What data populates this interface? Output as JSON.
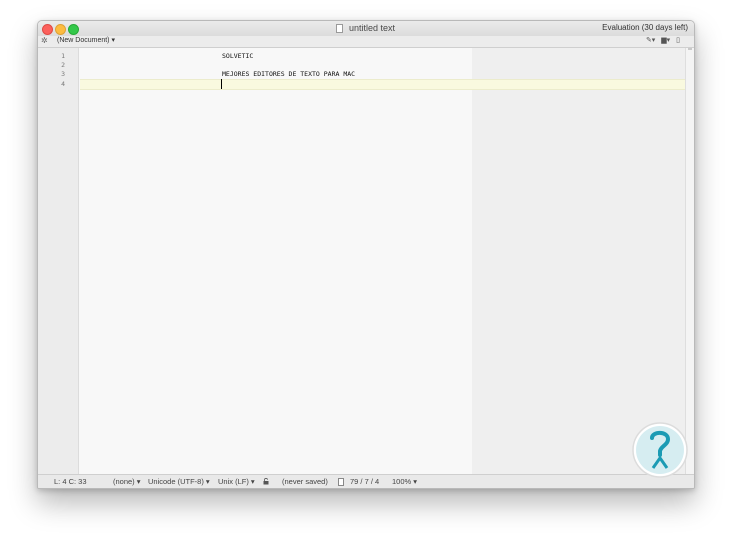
{
  "window": {
    "title": "untitled text",
    "evaluation": "Evaluation (30 days left)"
  },
  "toolbar": {
    "gear_icon": "gear-icon",
    "document_selector": "(New Document) ▾",
    "right_icons": [
      "pencil-icon",
      "copy-icon",
      "document-icon"
    ]
  },
  "editor": {
    "line_numbers": [
      "1",
      "2",
      "3",
      "4"
    ],
    "lines": [
      "SOLVETIC",
      "",
      "MEJORES EDITORES DE TEXTO PARA MAC",
      ""
    ],
    "current_line": 4
  },
  "statusbar": {
    "position": "L: 4 C: 33",
    "syntax": "(none) ▾",
    "encoding": "Unicode (UTF-8) ▾",
    "line_endings": "Unix (LF) ▾",
    "saved_state": "(never saved)",
    "counts": "79 / 7 / 4",
    "zoom": "100% ▾"
  },
  "colors": {
    "close": "#fc605c",
    "minimize": "#fdbc40",
    "maximize": "#34c84a",
    "current_line_highlight": "#f9f9df",
    "watermark": "#1b9bb4"
  }
}
